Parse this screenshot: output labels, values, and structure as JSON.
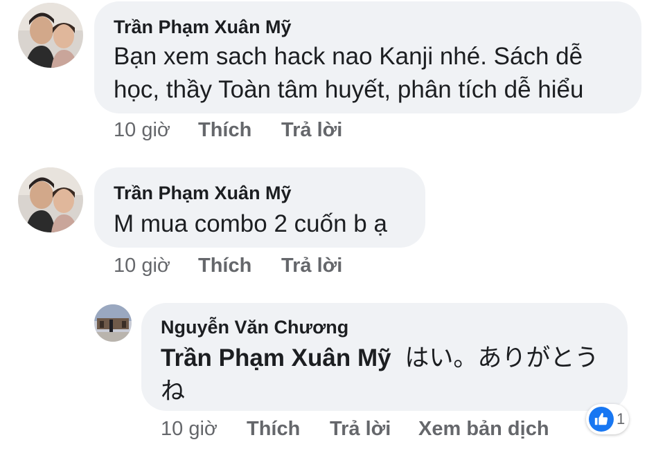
{
  "comments": [
    {
      "author": "Trần Phạm Xuân Mỹ",
      "text_line1": "Bạn xem sach hack nao Kanji nhé. Sách dễ",
      "text_line2": "học, thầy Toàn tâm huyết, phân tích dễ hiểu",
      "time": "10 giờ",
      "like_label": "Thích",
      "reply_label": "Trả lời"
    },
    {
      "author": "Trần Phạm Xuân Mỹ",
      "text_line1": "M mua combo 2 cuốn b ạ",
      "time": "10 giờ",
      "like_label": "Thích",
      "reply_label": "Trả lời"
    }
  ],
  "reply": {
    "author": "Nguyễn Văn Chương",
    "mention": "Trần Phạm Xuân Mỹ",
    "text_line1": "はい。ありがとう",
    "text_line2": "ね",
    "time": "10 giờ",
    "like_label": "Thích",
    "reply_label": "Trả lời",
    "translate_label": "Xem bản dịch",
    "reaction_count": "1",
    "reaction_icon": "like-icon"
  },
  "colors": {
    "bubble": "#f0f2f5",
    "secondary_text": "#65676b",
    "like_blue": "#1877f2"
  }
}
